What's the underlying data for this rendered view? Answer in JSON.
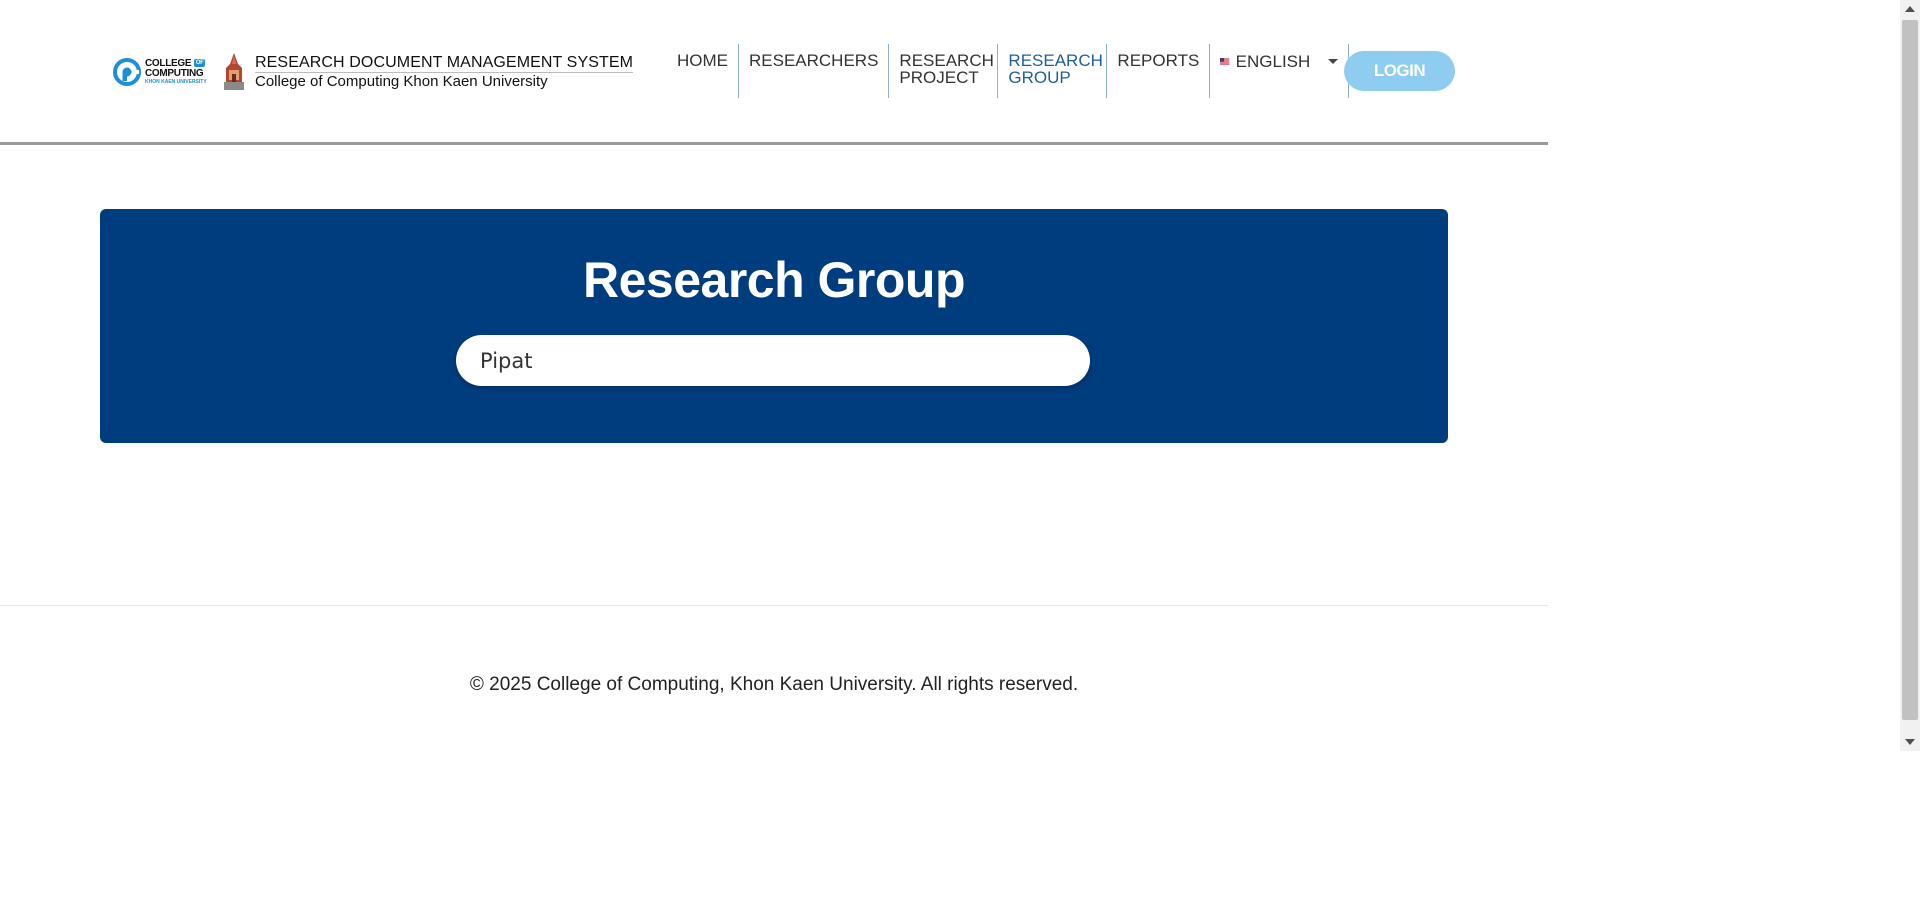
{
  "header": {
    "brand_title": "RESEARCH DOCUMENT MANAGEMENT SYSTEM",
    "brand_subtitle": "College of Computing Khon Kaen University",
    "logo": {
      "line1": "COLLEGE",
      "of": "OF",
      "line2": "COMPUTING",
      "line3": "KHON KAEN UNIVERSITY"
    },
    "nav": [
      {
        "label": "HOME",
        "active": false
      },
      {
        "label": "RESEARCHERS",
        "active": false
      },
      {
        "label": "RESEARCH PROJECT",
        "active": false
      },
      {
        "label": "RESEARCH GROUP",
        "active": true
      },
      {
        "label": "REPORTS",
        "active": false
      }
    ],
    "language": {
      "label": "ENGLISH",
      "flag": "us-flag-icon"
    },
    "login_label": "LOGIN"
  },
  "banner": {
    "title": "Research Group",
    "search_value": "Pipat"
  },
  "footer": {
    "copyright": "© 2025 College of Computing, Khon Kaen University. All rights reserved."
  },
  "colors": {
    "banner_bg": "#003d7e",
    "active_nav": "#1f5f98",
    "login_bg": "#8ecdf0",
    "logo_blue": "#1c8fd6"
  }
}
